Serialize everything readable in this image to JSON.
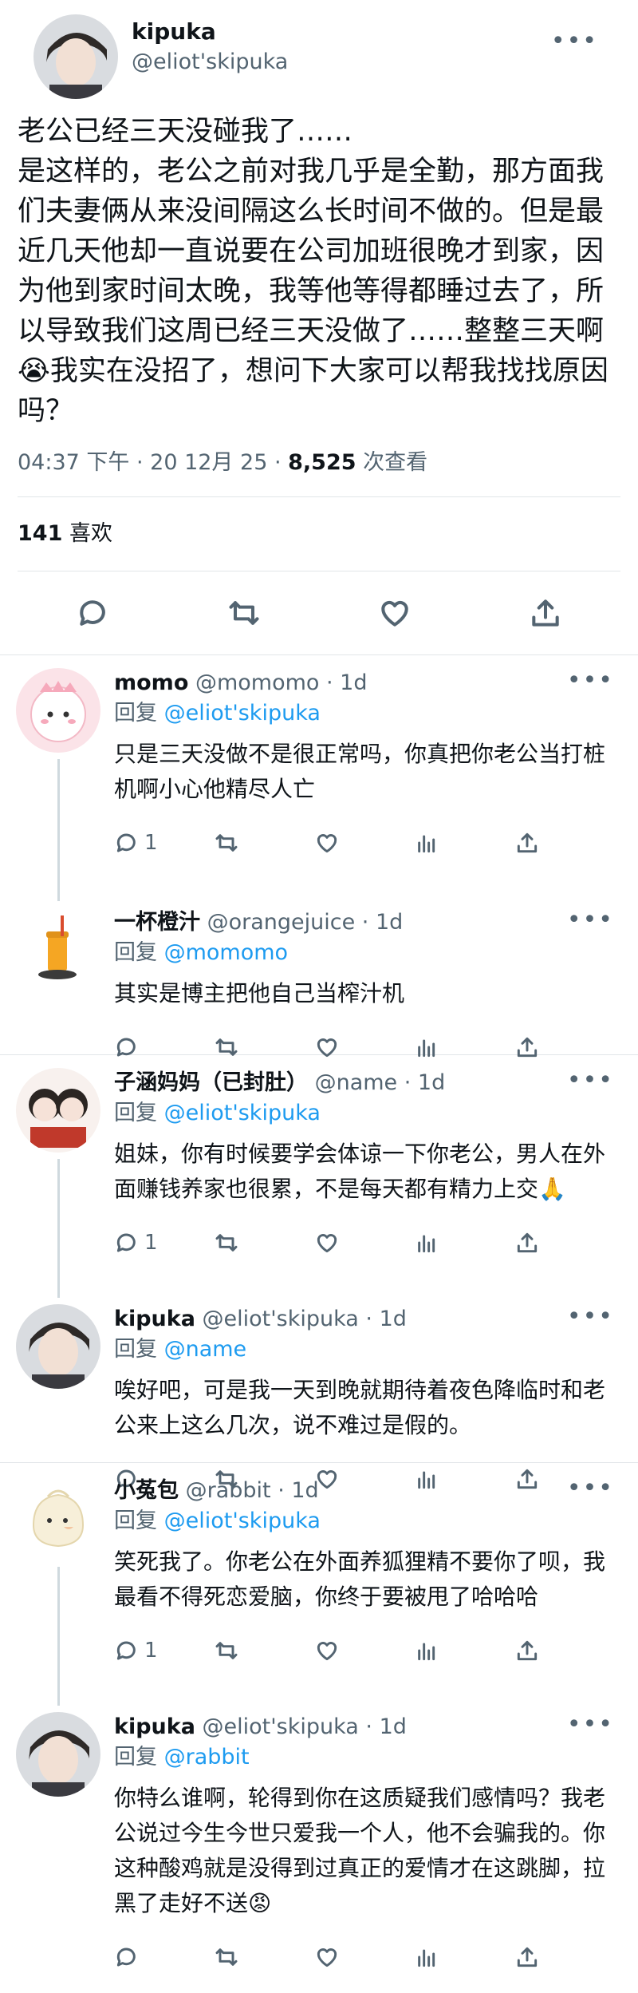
{
  "tweet": {
    "display_name": "kipuka",
    "handle": "@eliot'skipuka",
    "text_title": "老公已经三天没碰我了……",
    "text_body": "是这样的，老公之前对我几乎是全勤，那方面我们夫妻俩从来没间隔这么长时间不做的。但是最近几天他却一直说要在公司加班很晚才到家，因为他到家时间太晚，我等他等得都睡过去了，所以导致我们这周已经三天没做了……整整三天啊😭我实在没招了，想问下大家可以帮我找找原因吗？",
    "timestamp": "04:37 下午 · 20 12月 25 · ",
    "views_count": "8,525",
    "views_label": " 次查看",
    "likes_count": "141",
    "likes_label": " 喜欢"
  },
  "replies": [
    {
      "name": "momo",
      "handle": "@momomo",
      "time": " · 1d",
      "to_label": "回复 ",
      "to_handle": "@eliot'skipuka",
      "text": "只是三天没做不是很正常吗，你真把你老公当打桩机啊小心他精尽人亡",
      "reply_count": "1"
    },
    {
      "name": "一杯橙汁",
      "handle": "@orangejuice",
      "time": " · 1d",
      "to_label": "回复 ",
      "to_handle": "@momomo",
      "text": "其实是博主把他自己当榨汁机",
      "reply_count": ""
    },
    {
      "name": "子涵妈妈（已封肚）",
      "handle": "@name",
      "time": " · 1d",
      "to_label": "回复 ",
      "to_handle": "@eliot'skipuka",
      "text": "姐妹，你有时候要学会体谅一下你老公，男人在外面赚钱养家也很累，不是每天都有精力上交🙏",
      "reply_count": "1"
    },
    {
      "name": "kipuka",
      "handle": "@eliot'skipuka",
      "time": " · 1d",
      "to_label": "回复 ",
      "to_handle": "@name",
      "text": "唉好吧，可是我一天到晚就期待着夜色降临时和老公来上这么几次，说不难过是假的。",
      "reply_count": ""
    },
    {
      "name": "小菟包",
      "handle": "@rabbit",
      "time": " · 1d",
      "to_label": "回复 ",
      "to_handle": "@eliot'skipuka",
      "text": "笑死我了。你老公在外面养狐狸精不要你了呗，我最看不得死恋爱脑，你终于要被甩了哈哈哈",
      "reply_count": "1"
    },
    {
      "name": "kipuka",
      "handle": "@eliot'skipuka",
      "time": " · 1d",
      "to_label": "回复 ",
      "to_handle": "@rabbit",
      "text": "你特么谁啊，轮得到你在这质疑我们感情吗？我老公说过今生今世只爱我一个人，他不会骗我的。你这种酸鸡就是没得到过真正的爱情才在这跳脚，拉黑了走好不送😡",
      "reply_count": ""
    }
  ],
  "colors": {
    "link": "#1d9bf0",
    "secondary": "#536471"
  }
}
